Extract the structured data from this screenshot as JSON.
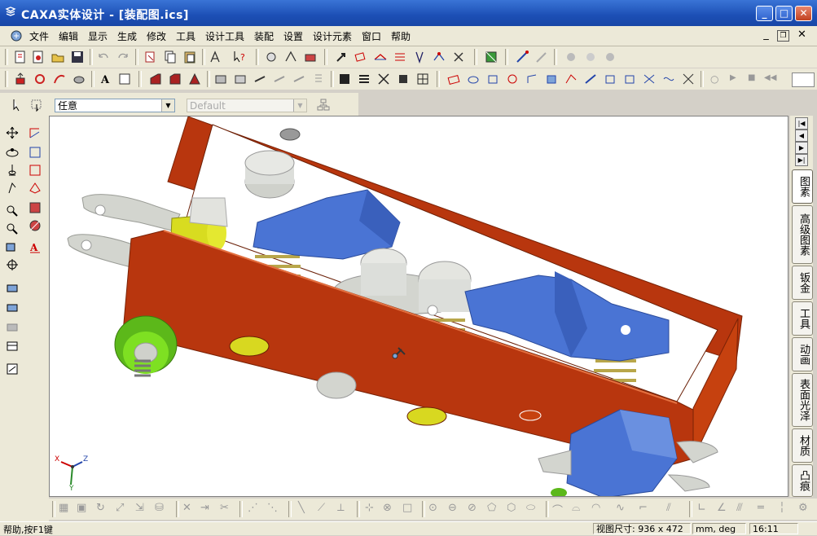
{
  "window": {
    "title": "CAXA实体设计 - [装配图.ics]"
  },
  "menu": {
    "items": [
      "文件",
      "编辑",
      "显示",
      "生成",
      "修改",
      "工具",
      "设计工具",
      "装配",
      "设置",
      "设计元素",
      "窗口",
      "帮助"
    ]
  },
  "selection": {
    "filter_value": "任意",
    "config_value": "Default"
  },
  "right_tabs": [
    "图素",
    "高级图素",
    "钣金",
    "工具",
    "动画",
    "表面光泽",
    "材质",
    "凸痕"
  ],
  "status": {
    "help": "帮助,按F1键",
    "viewport_size_label": "视图尺寸: 936 x 472",
    "units": "mm, deg",
    "time": "16:11"
  },
  "triad": {
    "x_label": "X",
    "y_label": "Y",
    "z_label": "Z"
  },
  "icons": {
    "app": "caxa-logo-icon",
    "minimize": "minimize-icon",
    "maximize": "maximize-icon",
    "close": "close-icon"
  },
  "colors": {
    "titlebar": "#1c4fb5",
    "frame_plate": "#c0390f",
    "blue_part": "#4a74d4",
    "green_part": "#6ed01e",
    "yellow_part": "#d8dc20",
    "grey_part": "#d5d7d0"
  }
}
